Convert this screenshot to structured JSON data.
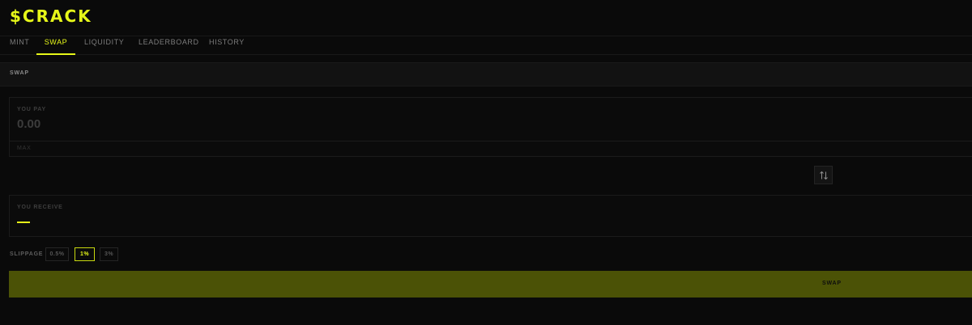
{
  "brand": {
    "logo": "$CRACK",
    "accent": "#e6f719"
  },
  "nav": {
    "tabs": [
      {
        "label": "MINT",
        "active": false
      },
      {
        "label": "SWAP",
        "active": true
      },
      {
        "label": "LIQUIDITY",
        "active": false
      },
      {
        "label": "LEADERBOARD",
        "active": false
      },
      {
        "label": "HISTORY",
        "active": false
      }
    ]
  },
  "section": {
    "title": "SWAP"
  },
  "pay": {
    "label": "YOU PAY",
    "value": "0.00",
    "max_label": "MAX"
  },
  "swap_direction": {
    "icon": "swap-vertical-arrows-icon"
  },
  "receive": {
    "label": "YOU RECEIVE",
    "value_indicator": "dash"
  },
  "slippage": {
    "label": "SLIPPAGE",
    "options": [
      {
        "label": "0.5%",
        "active": false
      },
      {
        "label": "1%",
        "active": true
      },
      {
        "label": "3%",
        "active": false
      }
    ]
  },
  "action": {
    "label": "SWAP",
    "color": "#4b5206"
  }
}
